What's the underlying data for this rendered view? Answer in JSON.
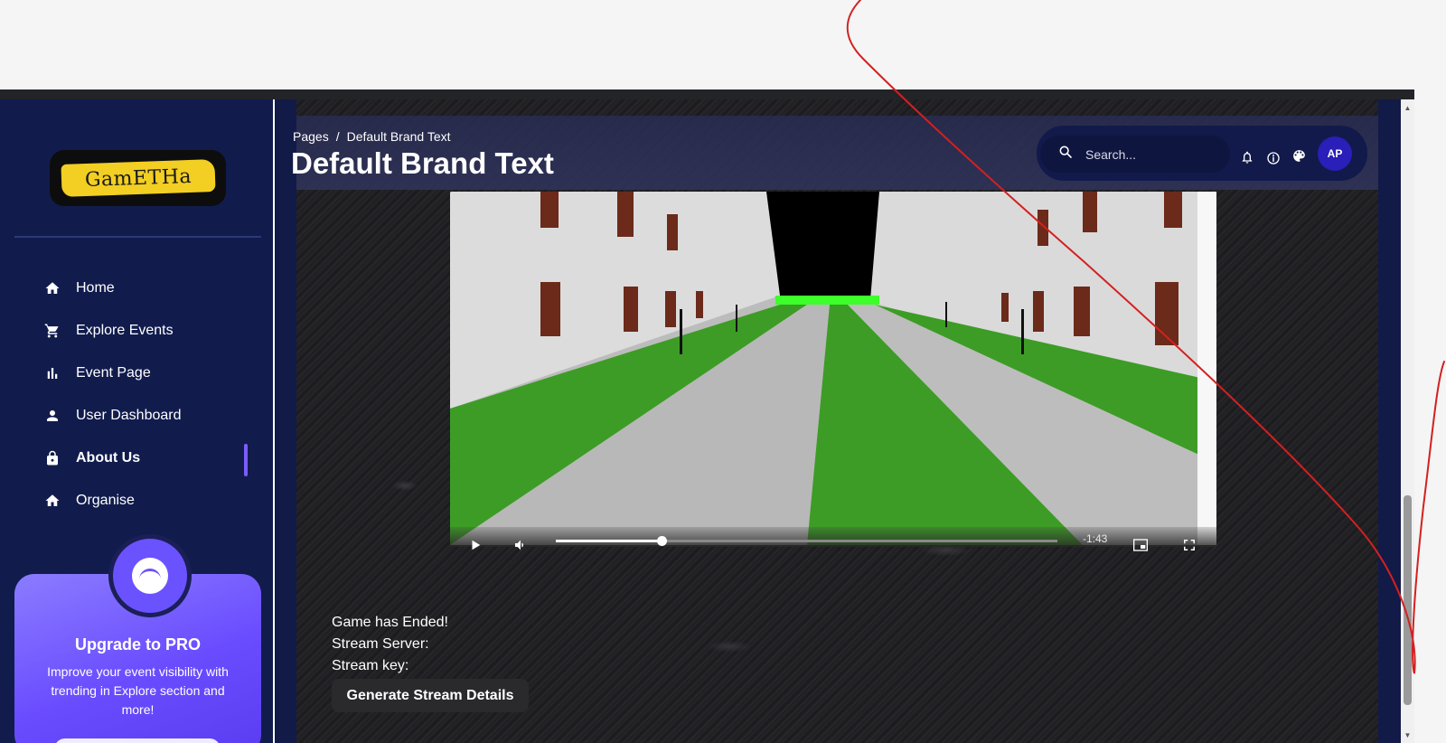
{
  "sidebar": {
    "logo_text": "GamETHa",
    "items": [
      {
        "label": "Home",
        "icon": "home-icon"
      },
      {
        "label": "Explore Events",
        "icon": "cart-icon"
      },
      {
        "label": "Event Page",
        "icon": "bar-chart-icon"
      },
      {
        "label": "User Dashboard",
        "icon": "user-icon"
      },
      {
        "label": "About Us",
        "icon": "lock-icon",
        "active": true
      },
      {
        "label": "Organise",
        "icon": "home-icon"
      }
    ],
    "promo": {
      "title": "Upgrade to PRO",
      "text": "Improve your event visibility with trending in Explore section and more!"
    }
  },
  "header": {
    "breadcrumb": {
      "root": "Pages",
      "separator": "/",
      "current": "Default Brand Text"
    },
    "title": "Default Brand Text",
    "search_placeholder": "Search...",
    "avatar_initials": "AP"
  },
  "video": {
    "time_remaining": "-1:43",
    "progress_fraction": 0.21
  },
  "stream": {
    "status": "Game has Ended!",
    "server_label": "Stream Server:",
    "key_label": "Stream key:",
    "generate_button": "Generate Stream Details"
  },
  "colors": {
    "sidebar_bg": "#111c4d",
    "accent": "#7b5cff",
    "header_bg": "#111a4a",
    "grass": "#3d9c26",
    "road": "#b8b8b8"
  }
}
